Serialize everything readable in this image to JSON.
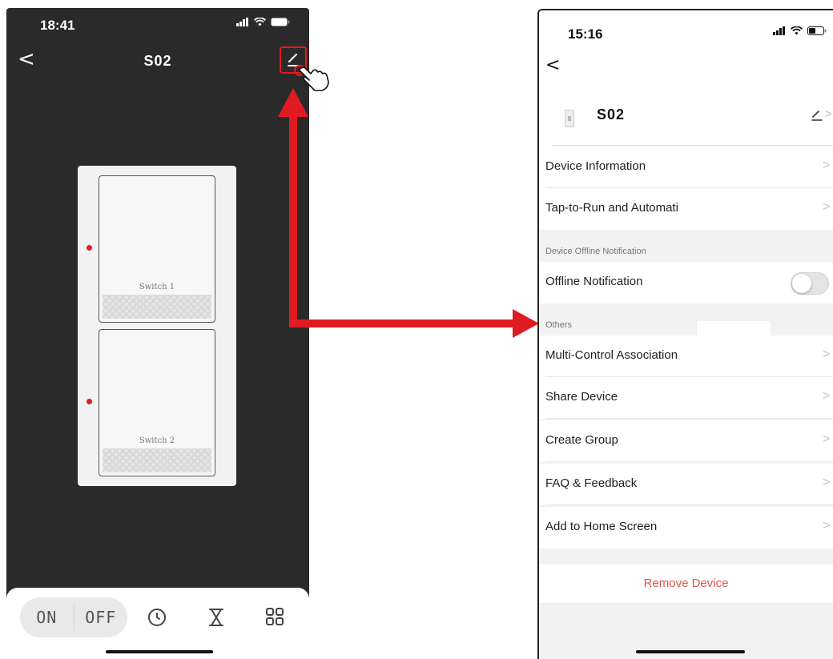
{
  "left_phone": {
    "status": {
      "time": "18:41"
    },
    "nav": {
      "back": "<",
      "title": "S02"
    },
    "switches": [
      {
        "label": "Switch 1"
      },
      {
        "label": "Switch 2"
      }
    ],
    "bottom_bar": {
      "on_label": "ON",
      "off_label": "OFF",
      "icons": [
        "clock-icon",
        "hourglass-icon",
        "grid-icon"
      ]
    }
  },
  "right_phone": {
    "status": {
      "time": "15:16"
    },
    "nav": {
      "back": "<"
    },
    "device": {
      "name": "S02",
      "chevron": ">"
    },
    "rows_top": [
      {
        "label": "Device Information",
        "chevron": ">"
      },
      {
        "label": "Tap-to-Run and Automati",
        "chevron": ">"
      }
    ],
    "section_offline": "Device Offline Notification",
    "offline_row": {
      "label": "Offline Notification",
      "toggle_on": false
    },
    "section_others": "Others",
    "rows_others": [
      {
        "label": "Multi-Control Association",
        "chevron": ">"
      },
      {
        "label": "Share Device",
        "chevron": ">"
      },
      {
        "label": "Create Group",
        "chevron": ">"
      },
      {
        "label": "FAQ & Feedback",
        "chevron": ">"
      },
      {
        "label": "Add to Home Screen",
        "chevron": ">"
      }
    ],
    "remove": "Remove Device"
  },
  "colors": {
    "annotation_red": "#e11b22",
    "remove_red": "#e0534f",
    "dark_bg": "#2a2a2a"
  }
}
